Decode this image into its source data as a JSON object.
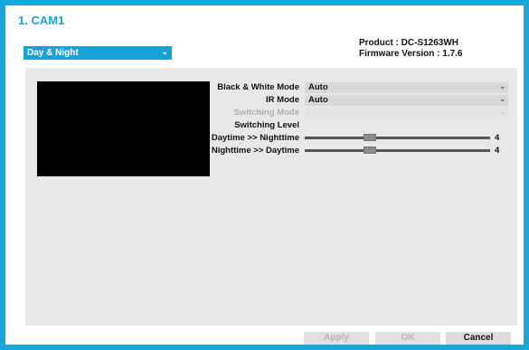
{
  "window": {
    "title": "1. CAM1"
  },
  "mode_select": {
    "value": "Day & Night"
  },
  "product_info": {
    "product": "Product : DC-S1263WH",
    "firmware": "Firmware Version : 1.7.6"
  },
  "settings": {
    "bw_mode": {
      "label": "Black & White Mode",
      "value": "Auto"
    },
    "ir_mode": {
      "label": "IR Mode",
      "value": "Auto"
    },
    "switching_mode": {
      "label": "Switching Mode",
      "value": ""
    },
    "switching_level": {
      "label": "Switching Level"
    },
    "day_to_night": {
      "label": "Daytime >> Nighttime",
      "value": "4",
      "level_fraction": 0.34
    },
    "night_to_day": {
      "label": "Nighttime >> Daytime",
      "value": "4",
      "level_fraction": 0.34
    }
  },
  "buttons": {
    "apply": "Apply",
    "ok": "OK",
    "cancel": "Cancel"
  },
  "colors": {
    "accent": "#17a3d6",
    "frame": "#1aa6d8"
  }
}
